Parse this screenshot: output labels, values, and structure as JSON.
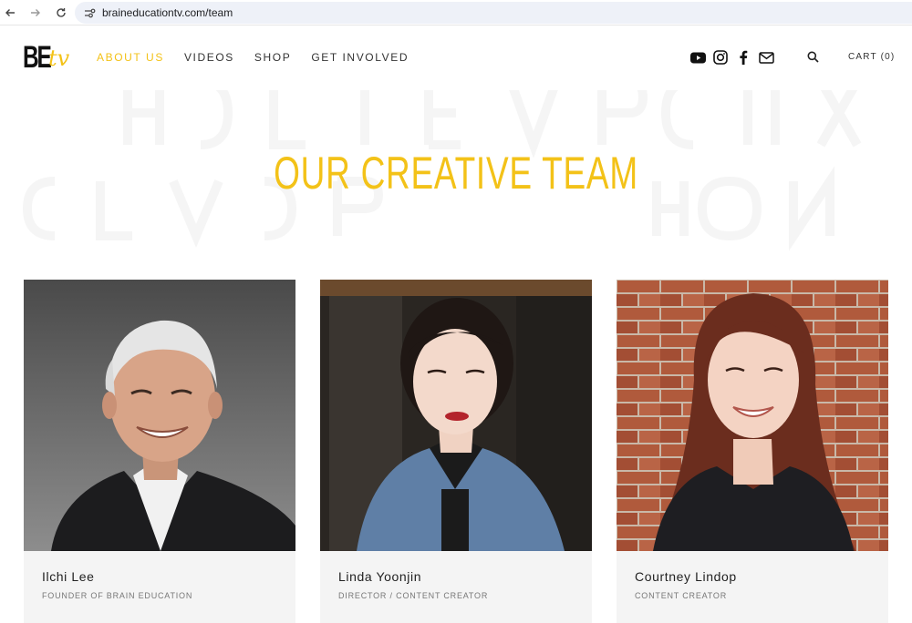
{
  "browser": {
    "url": "braineducationtv.com/team"
  },
  "logo": {
    "main": "BE",
    "accent": "tv"
  },
  "nav": {
    "items": [
      {
        "label": "ABOUT US",
        "active": true
      },
      {
        "label": "VIDEOS",
        "active": false
      },
      {
        "label": "SHOP",
        "active": false
      },
      {
        "label": "GET INVOLVED",
        "active": false
      }
    ]
  },
  "social": {
    "icons": [
      "youtube-icon",
      "instagram-icon",
      "facebook-icon",
      "mail-icon"
    ]
  },
  "cart": {
    "label": "CART (0)"
  },
  "hero": {
    "title": "OUR CREATIVE TEAM"
  },
  "team": {
    "members": [
      {
        "name": "Ilchi Lee",
        "role": "FOUNDER OF BRAIN EDUCATION"
      },
      {
        "name": "Linda Yoonjin",
        "role": "DIRECTOR / CONTENT CREATOR"
      },
      {
        "name": "Courtney Lindop",
        "role": "CONTENT CREATOR"
      }
    ]
  },
  "colors": {
    "accent": "#f3c218",
    "text": "#333333",
    "card_bg": "#f4f4f4"
  }
}
